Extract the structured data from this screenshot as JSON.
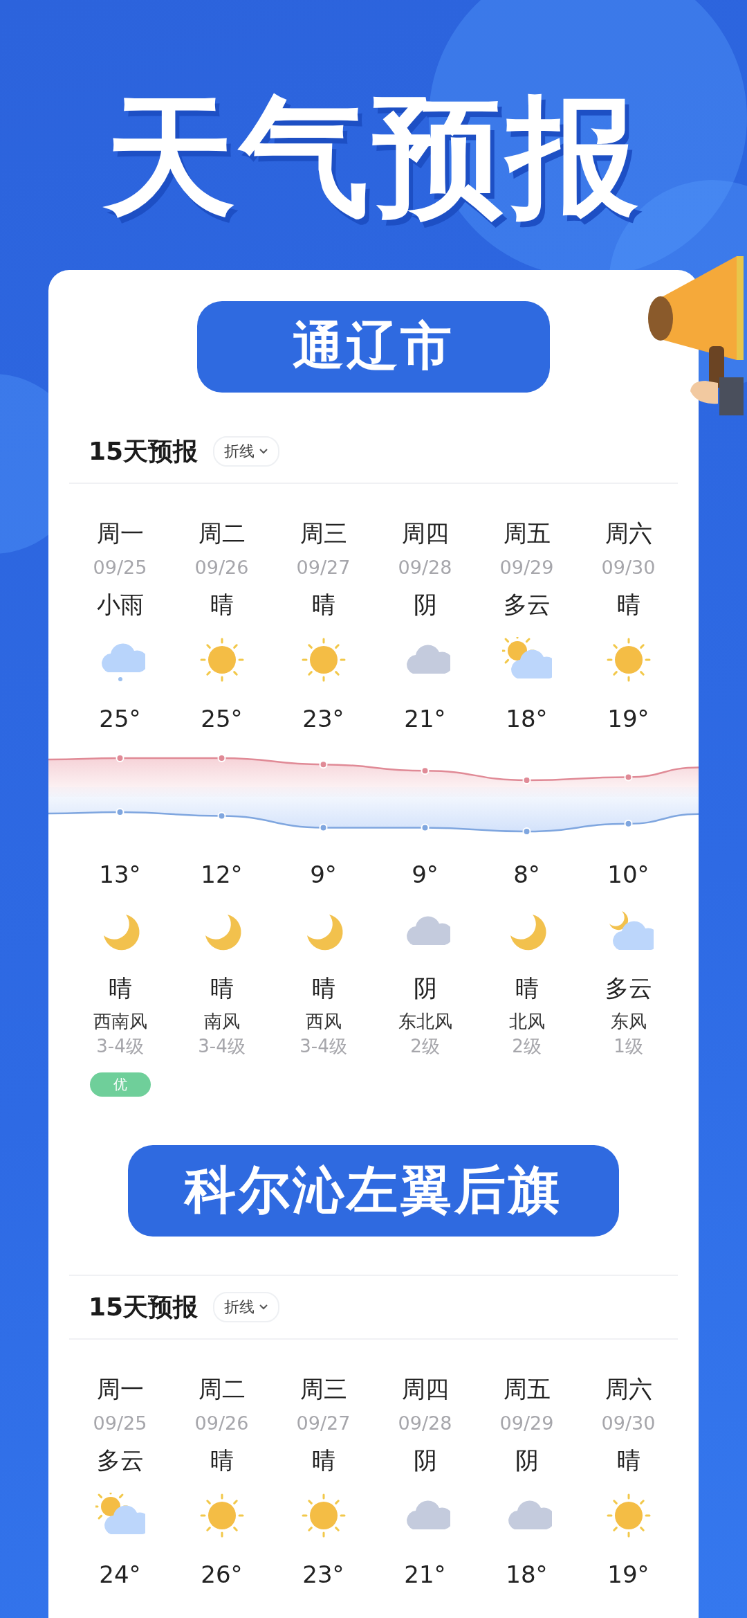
{
  "title": "天气预报",
  "cities": [
    {
      "name": "通辽市",
      "forecast": {
        "heading": "15天预报",
        "mode": "折线",
        "days": [
          {
            "weekday": "周一",
            "date": "09/25",
            "day": {
              "weather": "小雨",
              "kind": "rain"
            },
            "high": "25°",
            "low": "13°",
            "night": {
              "kind": "moon",
              "weather": "晴"
            },
            "wind": "西南风",
            "wind_level": "3-4级",
            "aqi": "优"
          },
          {
            "weekday": "周二",
            "date": "09/26",
            "day": {
              "weather": "晴",
              "kind": "sun"
            },
            "high": "25°",
            "low": "12°",
            "night": {
              "kind": "moon",
              "weather": "晴"
            },
            "wind": "南风",
            "wind_level": "3-4级"
          },
          {
            "weekday": "周三",
            "date": "09/27",
            "day": {
              "weather": "晴",
              "kind": "sun"
            },
            "high": "23°",
            "low": "9°",
            "night": {
              "kind": "moon",
              "weather": "晴"
            },
            "wind": "西风",
            "wind_level": "3-4级"
          },
          {
            "weekday": "周四",
            "date": "09/28",
            "day": {
              "weather": "阴",
              "kind": "overcast"
            },
            "high": "21°",
            "low": "9°",
            "night": {
              "kind": "overcast",
              "weather": "阴"
            },
            "wind": "东北风",
            "wind_level": "2级"
          },
          {
            "weekday": "周五",
            "date": "09/29",
            "day": {
              "weather": "多云",
              "kind": "partly"
            },
            "high": "18°",
            "low": "8°",
            "night": {
              "kind": "moon",
              "weather": "晴"
            },
            "wind": "北风",
            "wind_level": "2级"
          },
          {
            "weekday": "周六",
            "date": "09/30",
            "day": {
              "weather": "晴",
              "kind": "sun"
            },
            "high": "19°",
            "low": "10°",
            "night": {
              "kind": "partly_night",
              "weather": "多云"
            },
            "wind": "东风",
            "wind_level": "1级"
          }
        ]
      }
    },
    {
      "name": "科尔沁左翼后旗",
      "forecast": {
        "heading": "15天预报",
        "mode": "折线",
        "days": [
          {
            "weekday": "周一",
            "date": "09/25",
            "day": {
              "weather": "多云",
              "kind": "partly"
            },
            "high": "24°"
          },
          {
            "weekday": "周二",
            "date": "09/26",
            "day": {
              "weather": "晴",
              "kind": "sun"
            },
            "high": "26°"
          },
          {
            "weekday": "周三",
            "date": "09/27",
            "day": {
              "weather": "晴",
              "kind": "sun"
            },
            "high": "23°"
          },
          {
            "weekday": "周四",
            "date": "09/28",
            "day": {
              "weather": "阴",
              "kind": "overcast"
            },
            "high": "21°"
          },
          {
            "weekday": "周五",
            "date": "09/29",
            "day": {
              "weather": "阴",
              "kind": "overcast"
            },
            "high": "18°"
          },
          {
            "weekday": "周六",
            "date": "09/30",
            "day": {
              "weather": "晴",
              "kind": "sun"
            },
            "high": "19°"
          }
        ]
      }
    }
  ]
}
